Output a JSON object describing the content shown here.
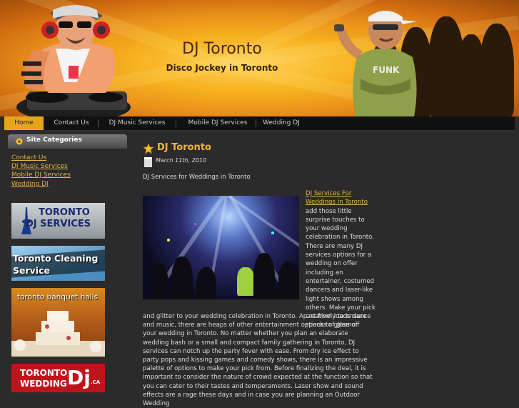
{
  "header": {
    "title": "DJ Toronto",
    "tagline": "Disco Jockey in Toronto"
  },
  "nav": {
    "items": [
      {
        "label": "Home",
        "active": true
      },
      {
        "label": "Contact Us"
      },
      {
        "label": "DJ Music Services"
      },
      {
        "label": "Mobile DJ Services"
      },
      {
        "label": "Wedding DJ"
      }
    ]
  },
  "sidebar": {
    "heading": "Site Categories",
    "categories": [
      "Contact Us",
      "DJ Music Services",
      "Mobile DJ Services",
      "Wedding DJ"
    ],
    "ads": [
      {
        "line1": "TORONTO",
        "line2": "DJ SERVICES"
      },
      {
        "line1": "Toronto Cleaning",
        "line2": "Service"
      },
      {
        "line1": "toronto banquet  halls"
      },
      {
        "line1": "TORONTO",
        "line2": "WEDDING",
        "mark": "Dj",
        "suffix": ".CA"
      }
    ]
  },
  "post": {
    "title": "DJ Toronto",
    "date": "March 11th, 2010",
    "subtitle": "DJ Services for Weddings in Toronto",
    "link_text": "DJ Services For Weddings in Toronto",
    "side_text": " add those little surprise touches to your wedding celebration in Toronto. There are many DJ services options for a wedding on offer including an entertainer, costumed dancers and laser-like light shows among others. Make your pick creatively to ensure specks of glamor",
    "body_text": "and glitter to your wedding celebration in Toronto. Apart from loads dance and music, there are heaps of other entertainment options to gloss off your wedding in Toronto. No matter whether you plan an elaborate wedding bash or a small and compact family gathering in Toronto, DJ services can notch up the party fever with ease. From dry ice effect to party pops and kissing games and comedy shows, there is an impressive palette of options to make your pick from. Before finalizing the deal, it is important to consider the nature of crowd expected at the function so that you can cater to their tastes and temperaments. Laser show and sound effects are a rage these days and in case you are planning an Outdoor Wedding"
  },
  "colors": {
    "accent": "#e6a61c",
    "link": "#e6b44a",
    "title": "#f0b838",
    "background": "#2b2b2b"
  }
}
